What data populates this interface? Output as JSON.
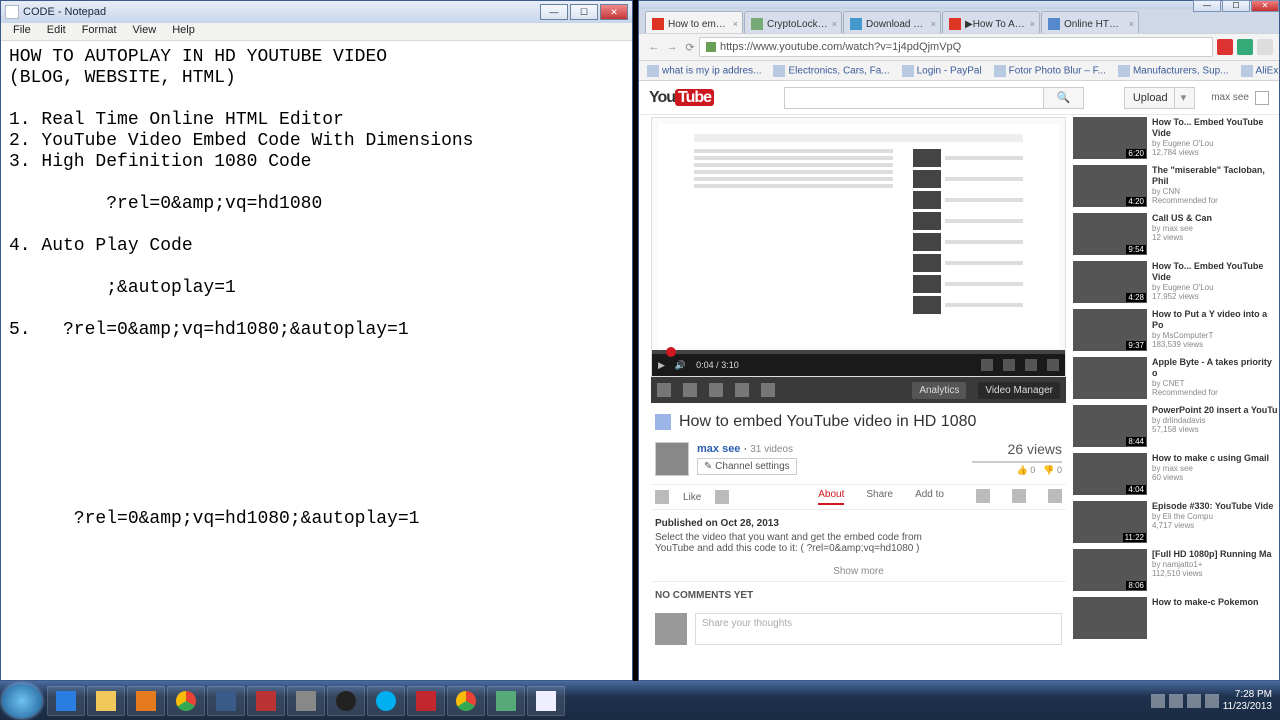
{
  "notepad": {
    "title": "CODE - Notepad",
    "menu": [
      "File",
      "Edit",
      "Format",
      "View",
      "Help"
    ],
    "body": "HOW TO AUTOPLAY IN HD YOUTUBE VIDEO\n(BLOG, WEBSITE, HTML)\n\n1. Real Time Online HTML Editor\n2. YouTube Video Embed Code With Dimensions\n3. High Definition 1080 Code\n\n         ?rel=0&amp;vq=hd1080\n\n4. Auto Play Code\n\n         ;&autoplay=1\n\n5.   ?rel=0&amp;vq=hd1080;&autoplay=1\n\n\n\n\n\n\n\n\n      ?rel=0&amp;vq=hd1080;&autoplay=1"
  },
  "chrome": {
    "tabs": [
      {
        "label": "How to embed Yo",
        "active": true
      },
      {
        "label": "CryptoLocker or V"
      },
      {
        "label": "Download Torren"
      },
      {
        "label": "▶How To Autopl"
      },
      {
        "label": "Online HTML Edi"
      }
    ],
    "url": "https://www.youtube.com/watch?v=1j4pdQjmVpQ",
    "bookmarks": [
      "what is my ip addres...",
      "Electronics, Cars, Fa...",
      "Login - PayPal",
      "Fotor Photo Blur – F...",
      "Manufacturers, Sup...",
      "AliExpress.com - On..."
    ]
  },
  "yt": {
    "logo_you": "You",
    "logo_tube": "Tube",
    "upload": "Upload",
    "user": "max see",
    "search_ph": "",
    "player": {
      "time_cur": "0:04",
      "time_dur": "3:10",
      "analytics": "Analytics",
      "vm": "Video Manager"
    },
    "title": "How to embed YouTube video in HD 1080",
    "channel": "max see",
    "videos": "31 videos",
    "channel_settings": "Channel settings",
    "views": "26 views",
    "likes": "0",
    "dislikes": "0",
    "like_label": "Like",
    "tabs": {
      "about": "About",
      "share": "Share",
      "addto": "Add to"
    },
    "desc_pub": "Published on Oct 28, 2013",
    "desc_body": "Select the video that you want and get the embed code from\nYouTube and add this code to it: ( ?rel=0&amp;vq=hd1080 )",
    "show_more": "Show more",
    "no_comments": "NO COMMENTS YET",
    "comment_ph": "Share your thoughts",
    "side": [
      {
        "t": "How To... Embed YouTube Vide",
        "by": "by Eugene O'Lou",
        "v": "12,784 views",
        "d": "6:20"
      },
      {
        "t": "The \"miserable\" Tacloban, Phil",
        "by": "by CNN",
        "v": "Recommended for",
        "d": "4:20"
      },
      {
        "t": "Call US & Can",
        "by": "by max see",
        "v": "12 views",
        "d": "9:54"
      },
      {
        "t": "How To... Embed YouTube Vide",
        "by": "by Eugene O'Lou",
        "v": "17,952 views",
        "d": "4:28"
      },
      {
        "t": "How to Put a Y video into a Po",
        "by": "by MsComputerT",
        "v": "183,539 views",
        "d": "9:37"
      },
      {
        "t": "Apple Byte - A takes priority o",
        "by": "by CNET",
        "v": "Recommended for",
        "d": ""
      },
      {
        "t": "PowerPoint 20 insert a YouTu",
        "by": "by drlindadavis",
        "v": "57,158 views",
        "d": "8:44"
      },
      {
        "t": "How to make c using Gmail",
        "by": "by max see",
        "v": "60 views",
        "d": "4:04"
      },
      {
        "t": "Episode #330: YouTube Vide",
        "by": "by Eli the Compu",
        "v": "4,717 views",
        "d": "11:22"
      },
      {
        "t": "[Full HD 1080p] Running Ma",
        "by": "by namjatto1+",
        "v": "112,510 views",
        "d": "8:06"
      },
      {
        "t": "How to make-c Pokemon",
        "by": "",
        "v": "",
        "d": ""
      }
    ]
  },
  "taskbar": {
    "time": "7:28 PM",
    "date": "11/23/2013"
  }
}
